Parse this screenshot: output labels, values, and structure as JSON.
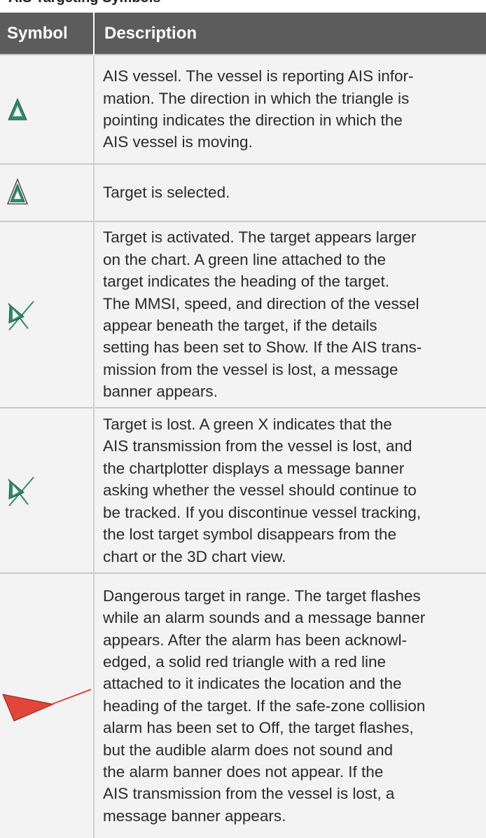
{
  "heading": "AIS Targeting Symbols",
  "table": {
    "col_symbol": "Symbol",
    "col_description": "Description"
  },
  "rows": [
    {
      "icon": "ais-vessel-triangle-icon",
      "lines": [
        "AIS vessel. The vessel is reporting AIS infor-",
        "mation. The direction in which the triangle is",
        "pointing indicates the direction in which the",
        "AIS vessel is moving."
      ]
    },
    {
      "icon": "selected-target-triangle-icon",
      "lines": [
        "Target is selected."
      ]
    },
    {
      "icon": "activated-target-icon",
      "lines": [
        "Target is activated. The target appears larger",
        "on the chart. A green line attached to the",
        "target indicates the heading of the target.",
        "The MMSI, speed, and direction of the vessel",
        "appear beneath the target, if the details",
        "setting has been set to Show. If the AIS trans-",
        "mission from the vessel is lost, a message",
        "banner appears."
      ]
    },
    {
      "icon": "lost-target-icon",
      "lines": [
        "Target is lost. A green X indicates that the",
        "AIS transmission from the vessel is lost, and",
        "the chartplotter displays a message banner",
        "asking whether the vessel should continue to",
        "be tracked. If you discontinue vessel tracking,",
        "the lost target symbol disappears from the",
        "chart or the 3D chart view."
      ]
    },
    {
      "icon": "dangerous-target-icon",
      "lines": [
        "Dangerous target in range. The target flashes",
        "while an alarm sounds and a message banner",
        "appears. After the alarm has been acknowl-",
        "edged, a solid red triangle with a red line",
        "attached to it indicates the location and the",
        "heading of the target. If the safe-zone collision",
        "alarm has been set to Off, the target flashes,",
        "but the audible alarm does not sound and",
        "the alarm banner does not appear. If the",
        "AIS transmission from the vessel is lost, a",
        "message banner appears."
      ]
    }
  ],
  "colors": {
    "header_bg": "#5c5c5c",
    "row_bg": "#f3f3f3",
    "ais_green": "#2e8b6b",
    "alarm_red": "#e2453a"
  }
}
